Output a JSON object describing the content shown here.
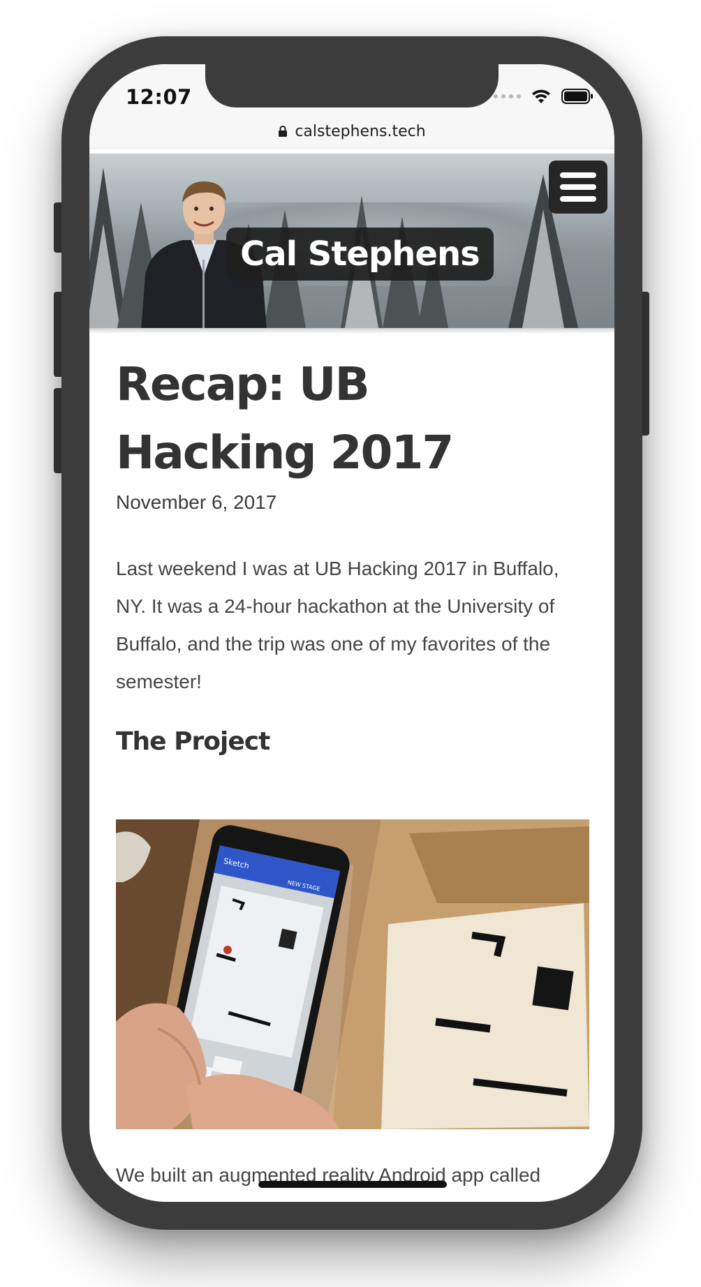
{
  "status_bar": {
    "time": "12:07"
  },
  "browser": {
    "url": "calstephens.tech"
  },
  "header": {
    "site_title": "Cal Stephens"
  },
  "article": {
    "title": "Recap: UB Hacking 2017",
    "date": "November 6, 2017",
    "intro": "Last weekend I was at UB Hacking 2017 in Buffalo, NY. It was a 24-hour hackathon at the University of Buffalo, and the trip was one of my favorites of the semester!",
    "section_heading": "The Project",
    "image_phone_app_title": "Sketch",
    "image_phone_button": "NEW STAGE",
    "next_paragraph_start": "We built an augmented reality Android app called"
  },
  "colors": {
    "device_frame": "#3c3c3c",
    "title_text": "#333333",
    "body_text": "#444444",
    "menu_button_bg": "#262626",
    "app_bar_blue": "#2f56c9"
  },
  "icons": {
    "lock": "lock-icon",
    "menu": "hamburger-menu-icon",
    "wifi": "wifi-icon",
    "battery": "battery-icon",
    "signal": "cellular-signal-icon"
  }
}
